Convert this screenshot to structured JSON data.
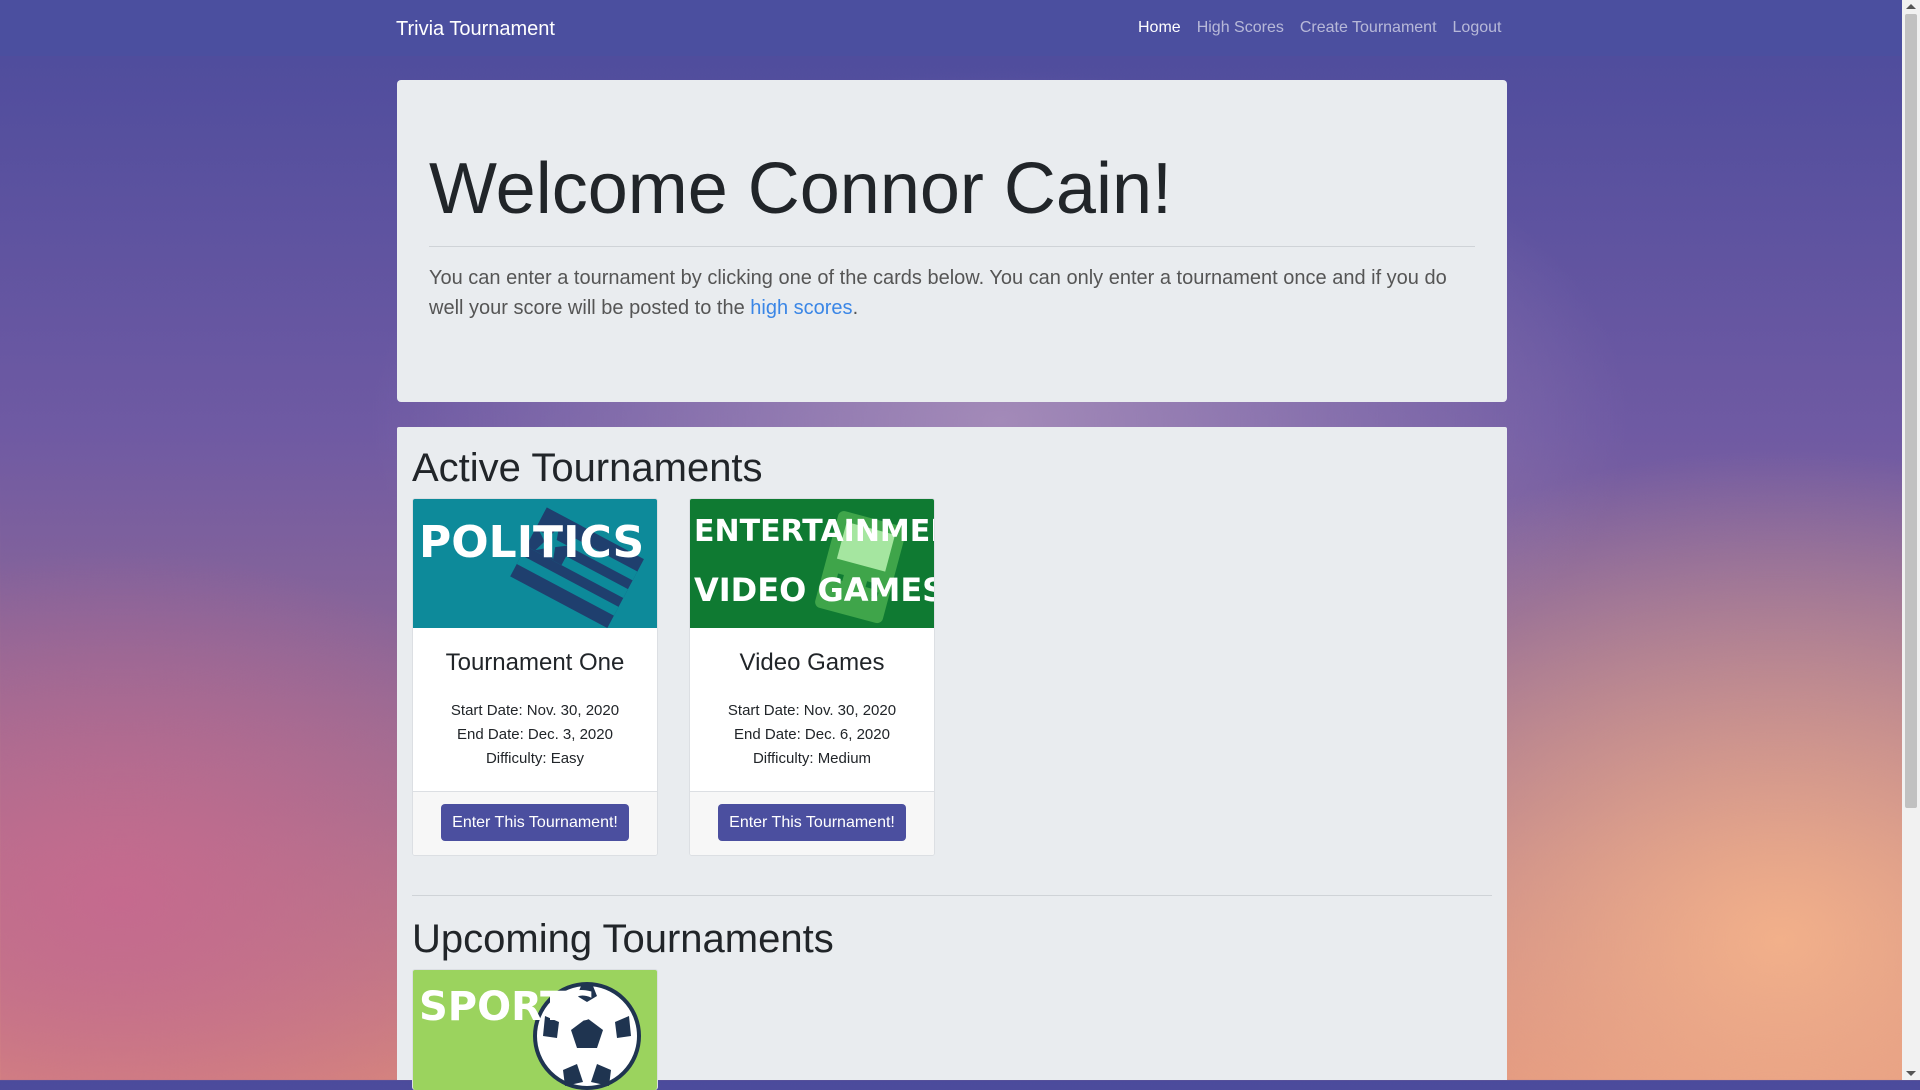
{
  "navbar": {
    "brand": "Trivia Tournament",
    "links": [
      {
        "label": "Home",
        "active": true
      },
      {
        "label": "High Scores",
        "active": false
      },
      {
        "label": "Create Tournament",
        "active": false
      },
      {
        "label": "Logout",
        "active": false
      }
    ]
  },
  "jumbotron": {
    "title": "Welcome Connor Cain!",
    "text_before": "You can enter a tournament by clicking one of the cards below. You can only enter a tournament once and if you do well your score will be posted to the ",
    "link_text": "high scores",
    "text_after": "."
  },
  "active": {
    "heading": "Active Tournaments",
    "cards": [
      {
        "image_label": "POLITICS",
        "image_icon": "flag-icon",
        "image_color": "#0d8a9a",
        "title": "Tournament One",
        "start": "Start Date: Nov. 30, 2020",
        "end": "End Date: Dec. 3, 2020",
        "difficulty": "Difficulty: Easy",
        "button": "Enter This Tournament!"
      },
      {
        "image_label_1": "ENTERTAINMENT:",
        "image_label_2": "VIDEO GAMES",
        "image_icon": "gameboy-icon",
        "image_color": "#0f7a32",
        "title": "Video Games",
        "start": "Start Date: Nov. 30, 2020",
        "end": "End Date: Dec. 6, 2020",
        "difficulty": "Difficulty: Medium",
        "button": "Enter This Tournament!"
      }
    ]
  },
  "upcoming": {
    "heading": "Upcoming Tournaments",
    "cards": [
      {
        "image_label": "SPORTS",
        "image_icon": "soccer-ball-icon",
        "image_color": "#9bd35e"
      }
    ]
  },
  "colors": {
    "navbar": "#4b4f9f",
    "button": "#4b4f9f",
    "link": "#3a86e6",
    "panel": "#e9ecef"
  }
}
